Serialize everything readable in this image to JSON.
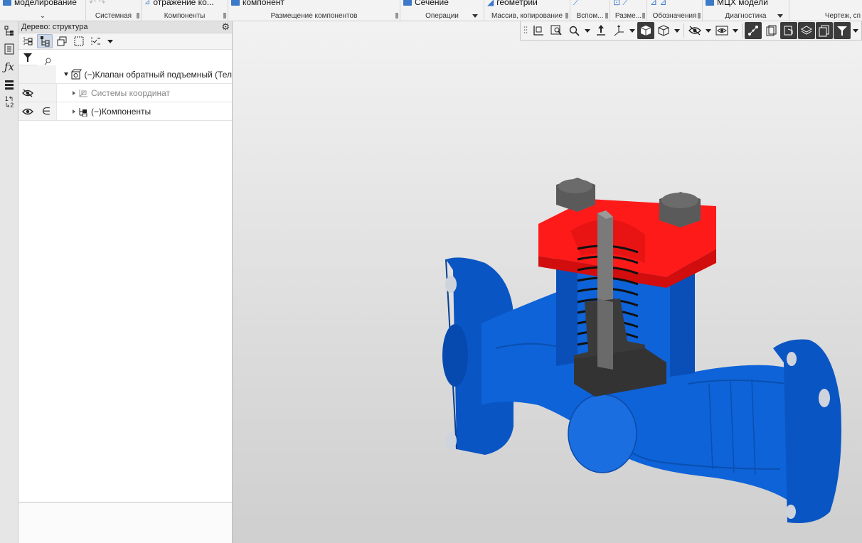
{
  "ribbon": {
    "groups": [
      {
        "id": "g1",
        "big_label": "моделирование",
        "caption": ""
      },
      {
        "id": "g2",
        "big_label": "",
        "caption": "Системная"
      },
      {
        "id": "g3",
        "big_label": "отражение ко...",
        "caption": "Компоненты"
      },
      {
        "id": "g4",
        "big_label": "компонент",
        "caption": "Размещение компонентов"
      },
      {
        "id": "g5",
        "big_label": "Сечение",
        "caption": "Операции"
      },
      {
        "id": "g6",
        "big_label": "геометрии",
        "caption": "Массив, копирование"
      },
      {
        "id": "g7",
        "big_label": "",
        "caption": "Вспом..."
      },
      {
        "id": "g8",
        "big_label": "",
        "caption": "Разме..."
      },
      {
        "id": "g9",
        "big_label": "",
        "caption": "Обозначения"
      },
      {
        "id": "g10",
        "big_label": "МЦХ модели",
        "caption": "Диагностика"
      },
      {
        "id": "g11",
        "big_label": "",
        "caption": "Чертеж, сп"
      }
    ]
  },
  "tree_panel": {
    "title": "Дерево: структура",
    "search": {
      "value": "",
      "placeholder": ""
    },
    "rows": [
      {
        "label": "(−)Клапан обратный подъемный (Тел",
        "dim": false
      },
      {
        "label": "Системы координат",
        "dim": true
      },
      {
        "label": "(−)Компоненты",
        "dim": false
      }
    ]
  },
  "icons": {
    "accent": "#3c7ac8",
    "section_red": "#ff1a1a",
    "body_blue": "#0a5fd6",
    "part_dark": "#3a3a3a"
  }
}
